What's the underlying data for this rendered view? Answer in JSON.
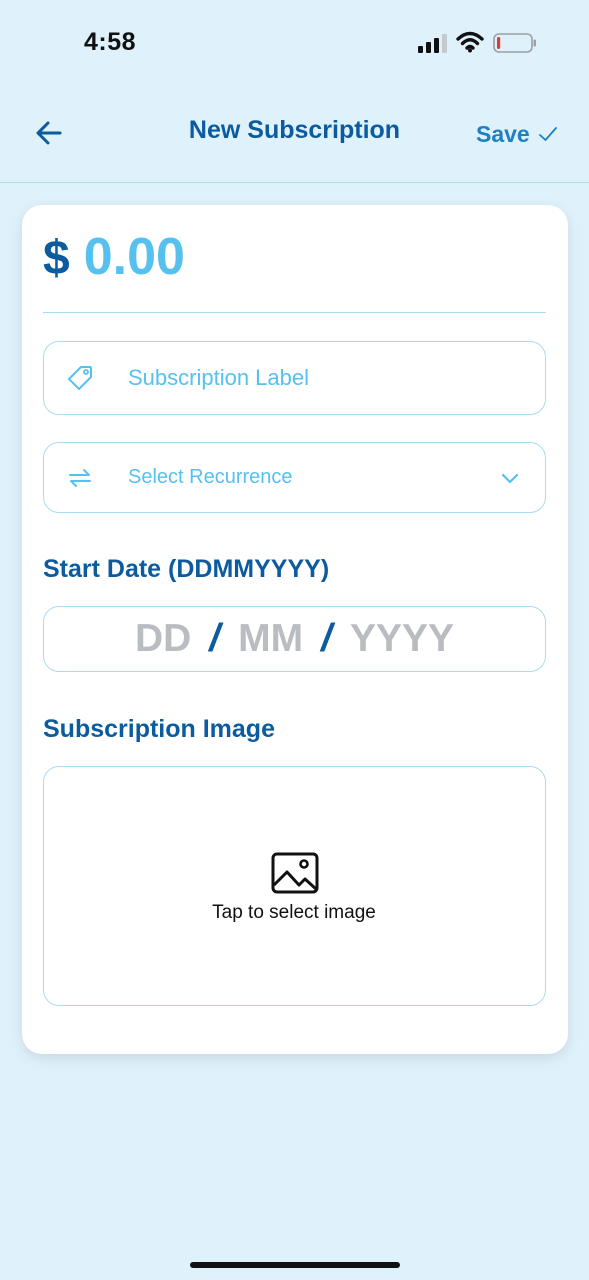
{
  "status_bar": {
    "time": "4:58",
    "battery_level": 0.1
  },
  "nav": {
    "title": "New Subscription",
    "save_label": "Save"
  },
  "form": {
    "amount_currency": "$",
    "amount_value": "0.00",
    "label_placeholder": "Subscription Label",
    "recurrence_placeholder": "Select Recurrence",
    "start_date_heading": "Start Date (DDMMYYYY)",
    "date_day_placeholder": "DD",
    "date_month_placeholder": "MM",
    "date_year_placeholder": "YYYY",
    "date_separator": "/",
    "image_heading": "Subscription Image",
    "image_caption": "Tap to select image"
  },
  "colors": {
    "background": "#dff1fb",
    "primary_dark": "#0b5b9e",
    "accent": "#56c1ef",
    "border": "#a9dbf1",
    "placeholder_gray": "#b9bcc1",
    "battery_low": "#e53935"
  },
  "icons": {
    "back": "arrow-left-icon",
    "save": "checkmark-icon",
    "label": "tag-icon",
    "recurrence": "repeat-icon",
    "dropdown": "chevron-down-icon",
    "image": "image-icon"
  }
}
